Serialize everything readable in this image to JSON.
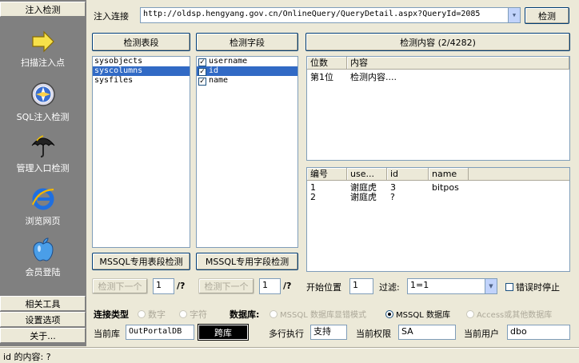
{
  "sidebar": {
    "top_tab": "注入检测",
    "items": [
      {
        "label": "扫描注入点",
        "icon": "arrow-right-icon"
      },
      {
        "label": "SQL注入检测",
        "icon": "compass-icon"
      },
      {
        "label": "管理入口检测",
        "icon": "umbrella-icon"
      },
      {
        "label": "浏览网页",
        "icon": "ie-browser-icon"
      },
      {
        "label": "会员登陆",
        "icon": "apple-icon"
      }
    ],
    "bottom_tabs": [
      "相关工具",
      "设置选项",
      "关于..."
    ]
  },
  "url_bar": {
    "label": "注入连接",
    "value": "http://oldsp.hengyang.gov.cn/OnlineQuery/QueryDetail.aspx?QueryId=2085",
    "detect_button": "检测"
  },
  "tables_panel": {
    "header": "检测表段",
    "items": [
      "sysobjects",
      "syscolumns",
      "sysfiles"
    ],
    "selected_index": 1,
    "mssql_button": "MSSQL专用表段检测",
    "next_button": "检测下一个",
    "page_value": "1",
    "page_suffix": "/?"
  },
  "fields_panel": {
    "header": "检测字段",
    "items": [
      {
        "label": "username",
        "checked": true
      },
      {
        "label": "id",
        "checked": true
      },
      {
        "label": "name",
        "checked": true
      }
    ],
    "selected_index": 1,
    "mssql_button": "MSSQL专用字段检测",
    "next_button": "检测下一个",
    "page_value": "1",
    "page_suffix": "/?"
  },
  "content_panel": {
    "header": "检测内容 (2/4282)",
    "top_grid": {
      "columns": [
        "位数",
        "内容"
      ],
      "rows": [
        [
          "第1位",
          "检测内容...."
        ]
      ]
    },
    "bottom_grid": {
      "columns": [
        "编号",
        "use...",
        "id",
        "name"
      ],
      "rows": [
        [
          "1",
          "谢庭虎",
          "3",
          "bitpos"
        ],
        [
          "2",
          "谢庭虎",
          "?",
          ""
        ]
      ]
    },
    "start_label": "开始位置",
    "start_value": "1",
    "filter_label": "过滤:",
    "filter_value": "1=1",
    "stop_on_error": "错误时停止"
  },
  "options": {
    "conn_type_label": "连接类型",
    "conn_numeric": "数字",
    "conn_char": "字符",
    "db_label": "数据库:",
    "db_mssql_error": "MSSQL 数据库显错模式",
    "db_mssql": "MSSQL 数据库",
    "db_access": "Access或其他数据库"
  },
  "info": {
    "cur_db_label": "当前库",
    "cur_db_value": "OutPortalDB",
    "cross_db_button": "跨库",
    "multi_exec_label": "多行执行",
    "multi_exec_value": "支持",
    "privilege_label": "当前权限",
    "privilege_value": "SA",
    "user_label": "当前用户",
    "user_value": "dbo"
  },
  "status_bar": "id 的内容: ?"
}
